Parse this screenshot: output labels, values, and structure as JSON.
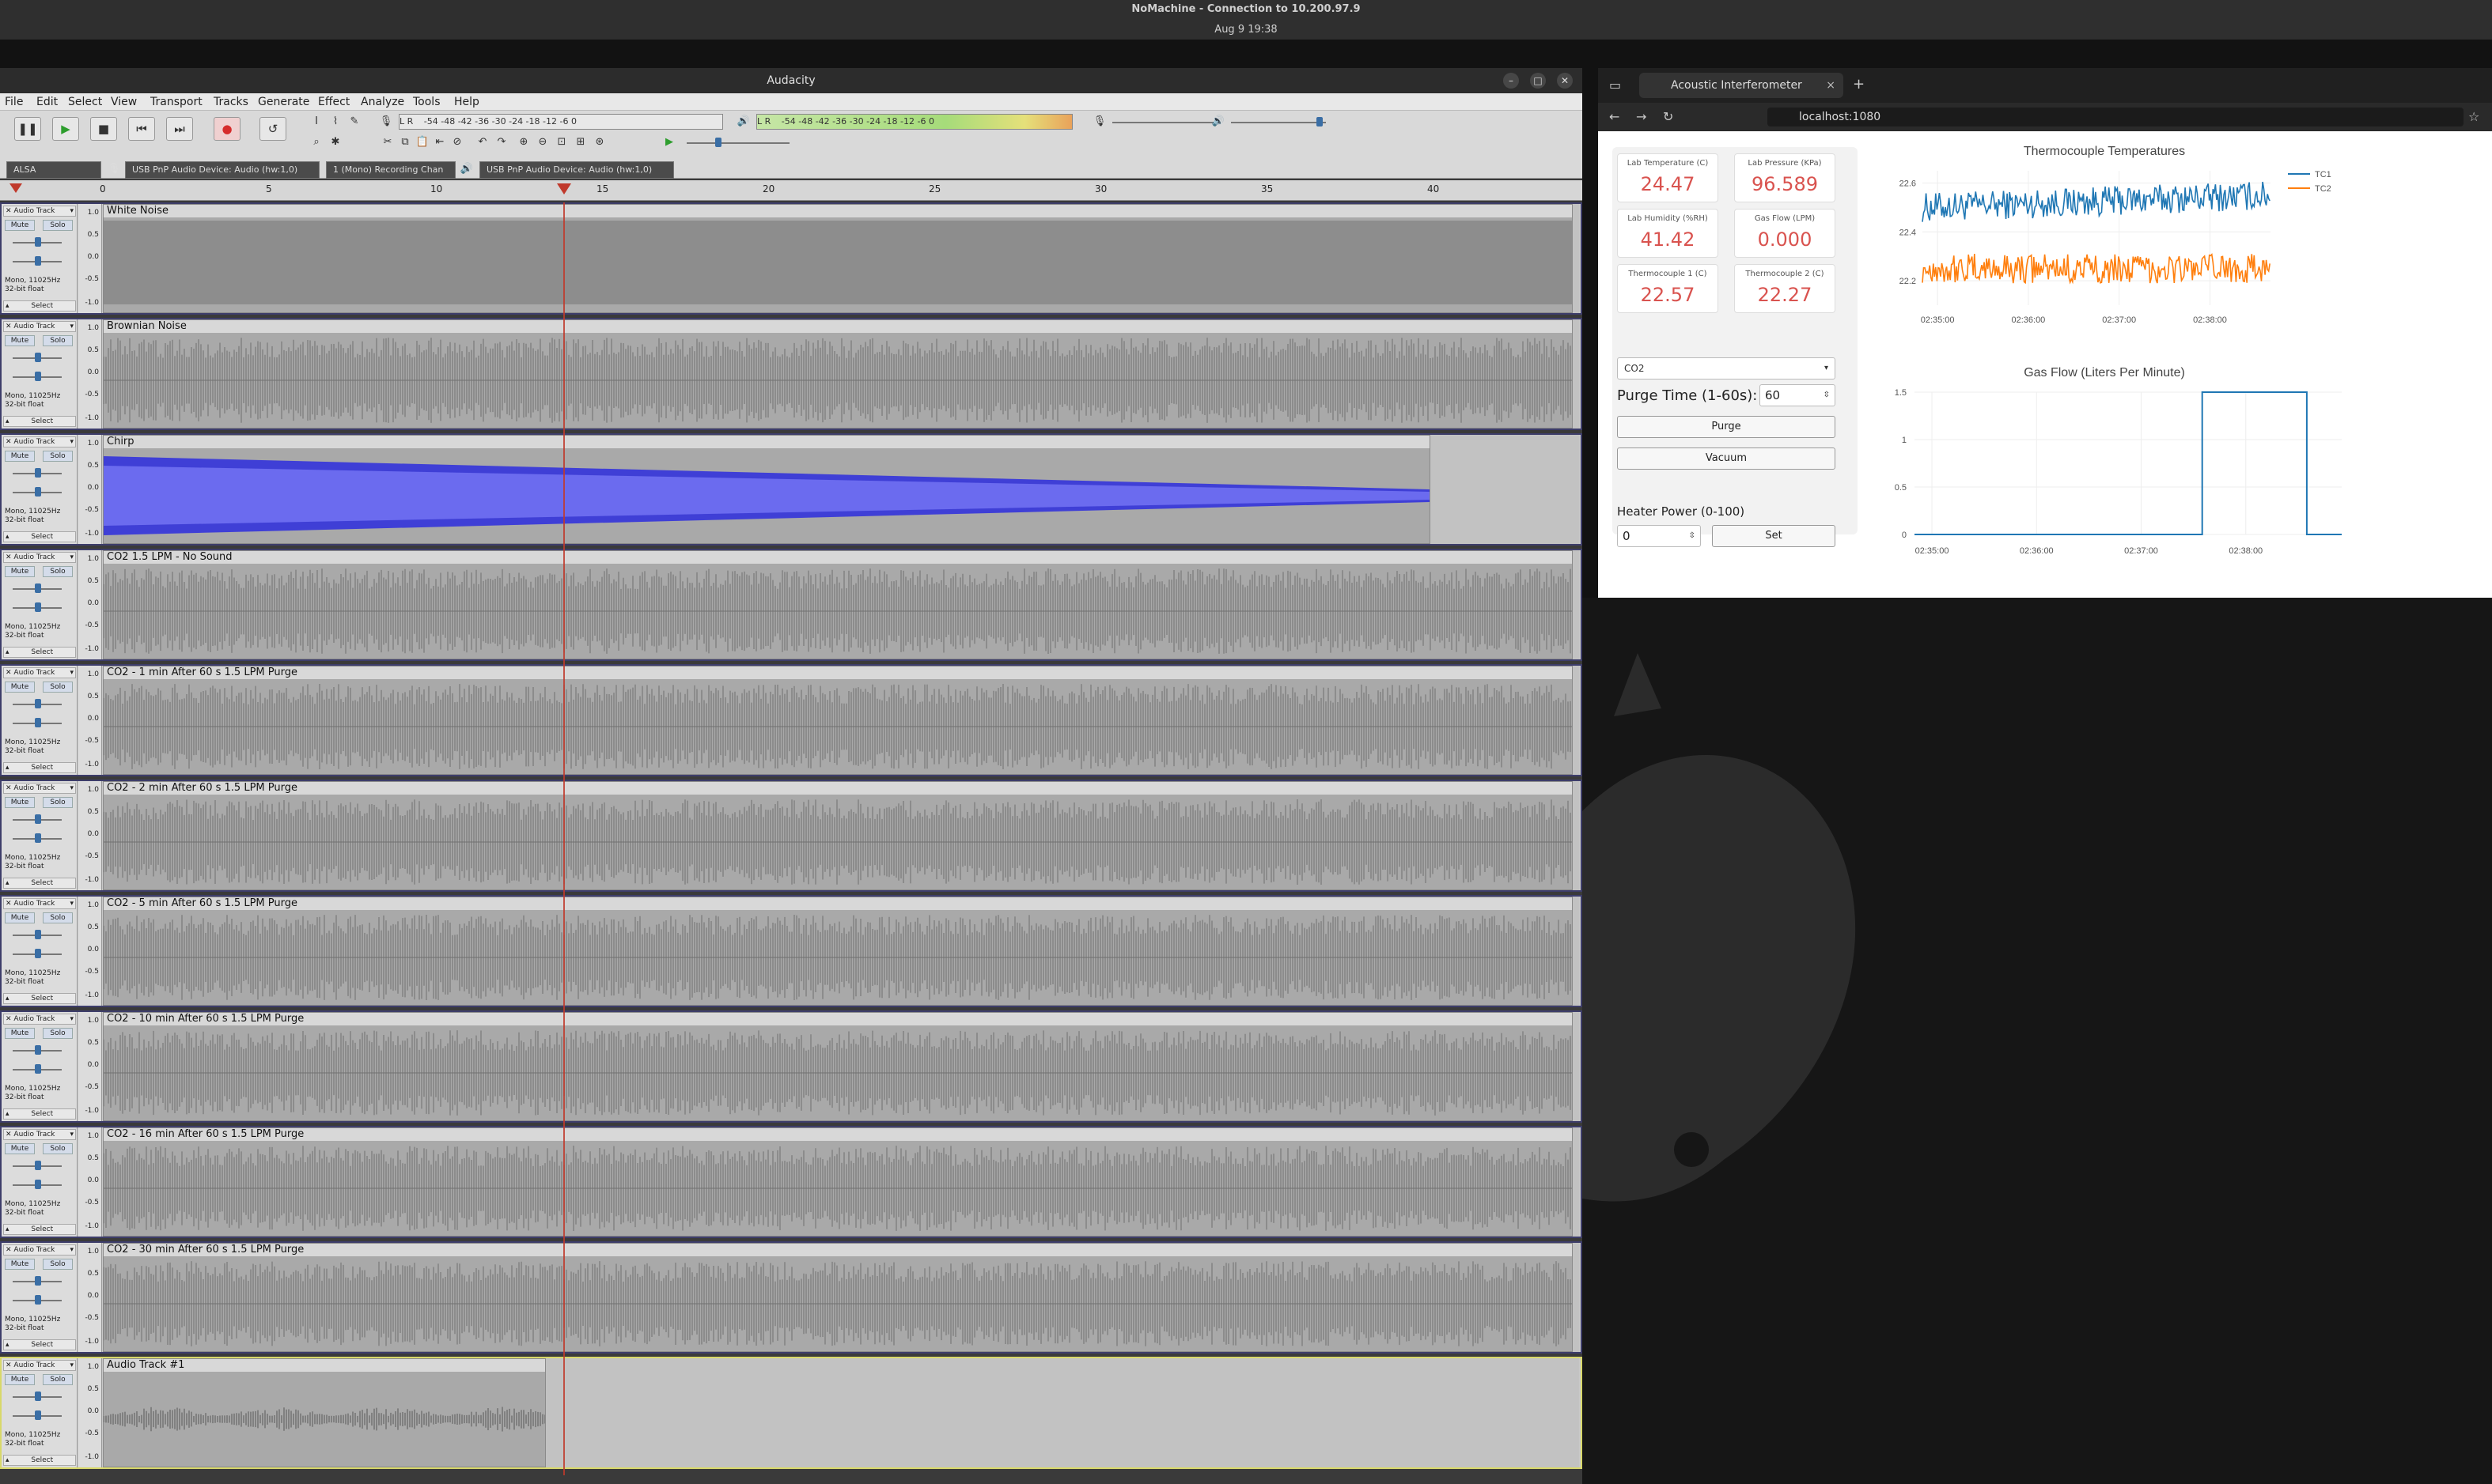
{
  "remote": {
    "title": "NoMachine - Connection to 10.200.97.9",
    "datetime": "Aug 9  19:38"
  },
  "audacity": {
    "title": "Audacity",
    "window_buttons": [
      "–",
      "□",
      "✕"
    ],
    "menu": [
      "File",
      "Edit",
      "Select",
      "View",
      "Transport",
      "Tracks",
      "Generate",
      "Effect",
      "Analyze",
      "Tools",
      "Help"
    ],
    "transport": {
      "pause": "❚❚",
      "play": "▶",
      "stop": "■",
      "skip_start": "⏮",
      "skip_end": "⏭",
      "record": "●",
      "loop": "↺"
    },
    "record_meter": {
      "letters": "L R",
      "scale": "-54 -48 -42 -36 -30 -24 -18 -12 -6 0"
    },
    "play_meter": {
      "letters": "L R",
      "scale": "-54 -48 -42 -36 -30 -24 -18 -12 -6 0"
    },
    "devices": {
      "host": "ALSA",
      "input": "USB PnP Audio Device: Audio (hw:1,0)",
      "channels": "1 (Mono) Recording Chan",
      "output": "USB PnP Audio Device: Audio (hw:1,0)"
    },
    "ruler": [
      "0",
      "5",
      "10",
      "15",
      "20",
      "25",
      "30",
      "35",
      "40"
    ],
    "track_common": {
      "menu_label": "Audio Track",
      "mute": "Mute",
      "solo": "Solo",
      "info": "Mono, 11025Hz\n32-bit float",
      "select": "Select",
      "scale": [
        "1.0",
        "0.5",
        "0.0",
        "-0.5",
        "-1.0"
      ]
    },
    "tracks": [
      {
        "name": "White Noise",
        "kind": "white"
      },
      {
        "name": "Brownian Noise",
        "kind": "noise"
      },
      {
        "name": "Chirp",
        "kind": "chirp"
      },
      {
        "name": "CO2 1.5 LPM - No Sound",
        "kind": "noise"
      },
      {
        "name": "CO2 - 1 min After 60 s 1.5 LPM Purge",
        "kind": "noise"
      },
      {
        "name": "CO2 - 2 min After 60 s 1.5 LPM Purge",
        "kind": "noise"
      },
      {
        "name": "CO2 - 5 min After 60 s 1.5 LPM Purge",
        "kind": "noise"
      },
      {
        "name": "CO2 - 10 min After 60 s 1.5 LPM Purge",
        "kind": "noise"
      },
      {
        "name": "CO2 - 16 min After 60 s 1.5 LPM Purge",
        "kind": "noise"
      },
      {
        "name": "CO2 - 30 min After 60 s 1.5 LPM Purge",
        "kind": "noise"
      },
      {
        "name": "Audio Track #1",
        "kind": "short"
      }
    ]
  },
  "browser": {
    "tab_title": "Acoustic Interferometer",
    "tab_close": "×",
    "new_tab": "+",
    "url": "localhost:1080",
    "nav": {
      "back": "←",
      "forward": "→",
      "reload": "↻",
      "bookmark": "☆"
    }
  },
  "dashboard": {
    "tiles": [
      {
        "label": "Lab Temperature (C)",
        "value": "24.47"
      },
      {
        "label": "Lab Pressure (KPa)",
        "value": "96.589"
      },
      {
        "label": "Lab Humidity (%RH)",
        "value": "41.42"
      },
      {
        "label": "Gas Flow (LPM)",
        "value": "0.000"
      },
      {
        "label": "Thermocouple 1 (C)",
        "value": "22.57"
      },
      {
        "label": "Thermocouple 2 (C)",
        "value": "22.27"
      }
    ],
    "value_color": "#d9534f",
    "gas": "CO2",
    "purge_label": "Purge Time (1-60s):",
    "purge_value": "60",
    "purge_button": "Purge",
    "vacuum_button": "Vacuum",
    "heater_label": "Heater Power (0-100)",
    "heater_value": "0",
    "set_button": "Set"
  },
  "chart_data": [
    {
      "type": "line",
      "title": "Thermocouple Temperatures",
      "x_ticks": [
        "02:35:00",
        "02:36:00",
        "02:37:00",
        "02:38:00"
      ],
      "x": [
        "02:34:50",
        "02:38:40"
      ],
      "ylim": [
        22.1,
        22.65
      ],
      "y_ticks": [
        "22.2",
        "22.4",
        "22.6"
      ],
      "legend": "top-right",
      "series": [
        {
          "name": "TC1",
          "color": "#1f77b4",
          "mean": 22.5,
          "amplitude": 0.06
        },
        {
          "name": "TC2",
          "color": "#ff7f0e",
          "mean": 22.25,
          "amplitude": 0.06
        }
      ]
    },
    {
      "type": "line",
      "title": "Gas Flow (Liters Per Minute)",
      "x_ticks": [
        "02:35:00",
        "02:36:00",
        "02:37:00",
        "02:38:00"
      ],
      "ylim": [
        0,
        1.5
      ],
      "y_ticks": [
        "0",
        "0.5",
        "1",
        "1.5"
      ],
      "color": "#1f77b4",
      "points": [
        [
          "02:34:50",
          0
        ],
        [
          "02:37:35",
          0
        ],
        [
          "02:37:35",
          1.5
        ],
        [
          "02:38:35",
          1.5
        ],
        [
          "02:38:35",
          0
        ],
        [
          "02:38:55",
          0
        ]
      ]
    }
  ]
}
